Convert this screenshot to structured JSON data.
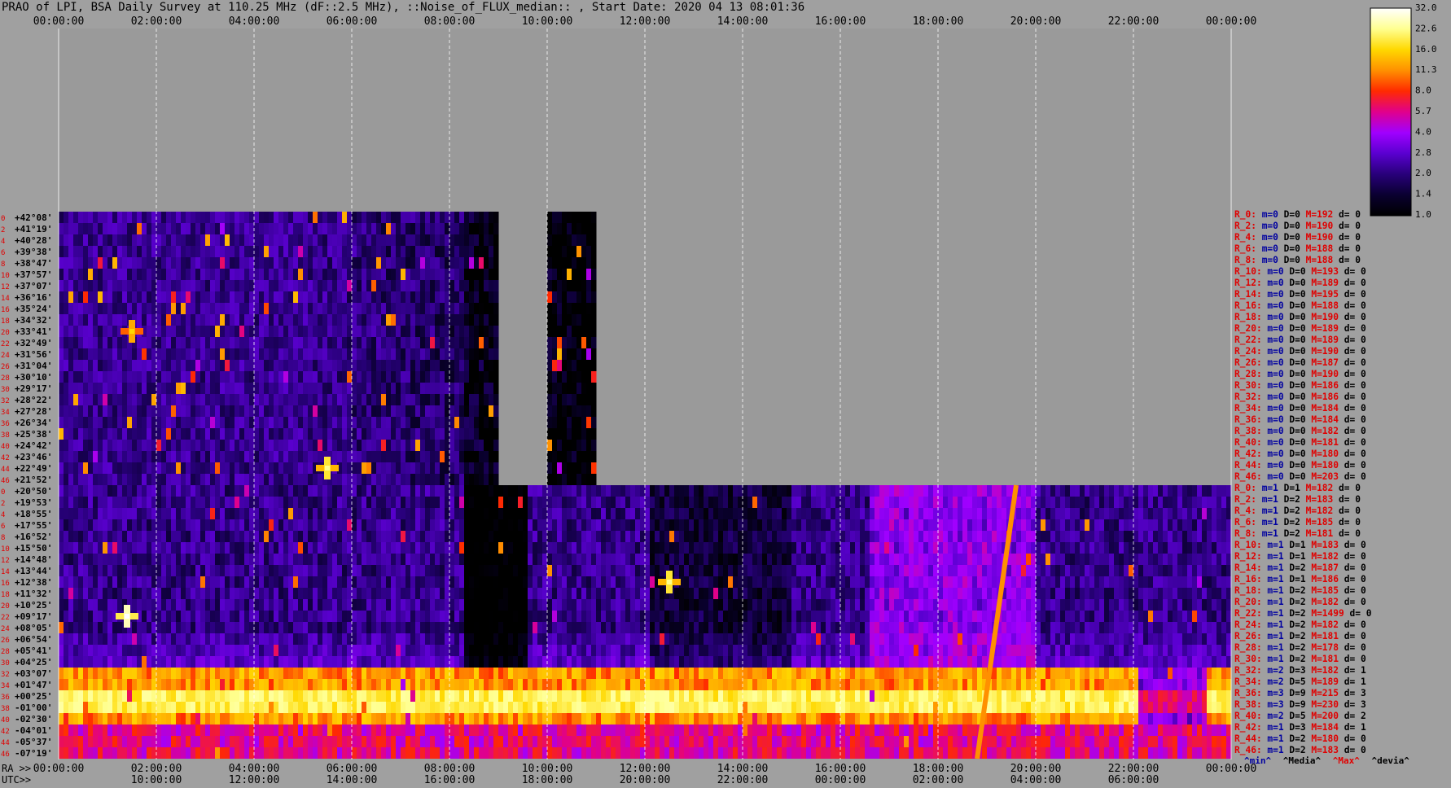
{
  "header": {
    "title": "PRAO of LPI, BSA Daily Survey at 110.25 MHz (dF::2.5 MHz), ::Noise_of_FLUX_median:: , Start Date: 2020 04 13 08:01:36"
  },
  "axes": {
    "ra_prefix": "RA >>",
    "utc_prefix": "UTC>>",
    "top_ticks": [
      "00:00:00",
      "02:00:00",
      "04:00:00",
      "06:00:00",
      "08:00:00",
      "10:00:00",
      "12:00:00",
      "14:00:00",
      "16:00:00",
      "18:00:00",
      "20:00:00",
      "22:00:00",
      "00:00:00"
    ],
    "ra_ticks": [
      "00:00:00",
      "02:00:00",
      "04:00:00",
      "06:00:00",
      "08:00:00",
      "10:00:00",
      "12:00:00",
      "14:00:00",
      "16:00:00",
      "18:00:00",
      "20:00:00",
      "22:00:00",
      "00:00:00"
    ],
    "utc_ticks": [
      "10:00:00",
      "12:00:00",
      "14:00:00",
      "16:00:00",
      "18:00:00",
      "20:00:00",
      "22:00:00",
      "00:00:00",
      "02:00:00",
      "04:00:00",
      "06:00:00"
    ]
  },
  "declinations": {
    "block1": [
      "+42°08'",
      "+41°19'",
      "+40°28'",
      "+39°38'",
      "+38°47'",
      "+37°57'",
      "+37°07'",
      "+36°16'",
      "+35°24'",
      "+34°32'",
      "+33°41'",
      "+32°49'",
      "+31°56'",
      "+31°04'",
      "+30°10'",
      "+29°17'",
      "+28°22'",
      "+27°28'",
      "+26°34'",
      "+25°38'",
      "+24°42'",
      "+23°46'",
      "+22°49'",
      "+21°52'"
    ],
    "block2": [
      "+20°50'",
      "+19°53'",
      "+18°55'",
      "+17°55'",
      "+16°52'",
      "+15°50'",
      "+14°48'",
      "+13°44'",
      "+12°38'",
      "+11°32'",
      "+10°25'",
      "+09°17'",
      "+08°05'",
      "+06°54'",
      "+05°41'",
      "+04°25'",
      "+03°07'",
      "+01°47'",
      "+00°25'",
      "-01°00'",
      "-02°30'",
      "-04°01'",
      "-05°37'",
      "-07°19'"
    ]
  },
  "row_indices": {
    "block1": [
      "0",
      "2",
      "4",
      "6",
      "8",
      "10",
      "12",
      "14",
      "16",
      "18",
      "20",
      "22",
      "24",
      "26",
      "28",
      "30",
      "32",
      "34",
      "36",
      "38",
      "40",
      "42",
      "44",
      "46"
    ],
    "block2": [
      "0",
      "2",
      "4",
      "6",
      "8",
      "10",
      "12",
      "14",
      "16",
      "18",
      "20",
      "22",
      "24",
      "26",
      "28",
      "30",
      "32",
      "34",
      "36",
      "38",
      "40",
      "42",
      "44",
      "46"
    ]
  },
  "colorbar": {
    "labels": [
      "32.0",
      "22.6",
      "16.0",
      "11.3",
      "8.0",
      "5.7",
      "4.0",
      "2.8",
      "2.0",
      "1.4",
      "1.0"
    ],
    "stops": [
      "#ffffff",
      "#ffff90",
      "#ffd800",
      "#ff9000",
      "#ff2a00",
      "#e0008c",
      "#a000ff",
      "#5a00d0",
      "#28007a",
      "#0a0030",
      "#000000"
    ]
  },
  "stats": {
    "rows": [
      {
        "r": "R_0:",
        "m": "m=0",
        "D": "D=0",
        "M": "M=192",
        "d": "d= 0"
      },
      {
        "r": "R_2:",
        "m": "m=0",
        "D": "D=0",
        "M": "M=190",
        "d": "d= 0"
      },
      {
        "r": "R_4:",
        "m": "m=0",
        "D": "D=0",
        "M": "M=190",
        "d": "d= 0"
      },
      {
        "r": "R_6:",
        "m": "m=0",
        "D": "D=0",
        "M": "M=188",
        "d": "d= 0"
      },
      {
        "r": "R_8:",
        "m": "m=0",
        "D": "D=0",
        "M": "M=188",
        "d": "d= 0"
      },
      {
        "r": "R_10:",
        "m": "m=0",
        "D": "D=0",
        "M": "M=193",
        "d": "d= 0"
      },
      {
        "r": "R_12:",
        "m": "m=0",
        "D": "D=0",
        "M": "M=189",
        "d": "d= 0"
      },
      {
        "r": "R_14:",
        "m": "m=0",
        "D": "D=0",
        "M": "M=195",
        "d": "d= 0"
      },
      {
        "r": "R_16:",
        "m": "m=0",
        "D": "D=0",
        "M": "M=188",
        "d": "d= 0"
      },
      {
        "r": "R_18:",
        "m": "m=0",
        "D": "D=0",
        "M": "M=190",
        "d": "d= 0"
      },
      {
        "r": "R_20:",
        "m": "m=0",
        "D": "D=0",
        "M": "M=189",
        "d": "d= 0"
      },
      {
        "r": "R_22:",
        "m": "m=0",
        "D": "D=0",
        "M": "M=189",
        "d": "d= 0"
      },
      {
        "r": "R_24:",
        "m": "m=0",
        "D": "D=0",
        "M": "M=190",
        "d": "d= 0"
      },
      {
        "r": "R_26:",
        "m": "m=0",
        "D": "D=0",
        "M": "M=187",
        "d": "d= 0"
      },
      {
        "r": "R_28:",
        "m": "m=0",
        "D": "D=0",
        "M": "M=190",
        "d": "d= 0"
      },
      {
        "r": "R_30:",
        "m": "m=0",
        "D": "D=0",
        "M": "M=186",
        "d": "d= 0"
      },
      {
        "r": "R_32:",
        "m": "m=0",
        "D": "D=0",
        "M": "M=186",
        "d": "d= 0"
      },
      {
        "r": "R_34:",
        "m": "m=0",
        "D": "D=0",
        "M": "M=184",
        "d": "d= 0"
      },
      {
        "r": "R_36:",
        "m": "m=0",
        "D": "D=0",
        "M": "M=184",
        "d": "d= 0"
      },
      {
        "r": "R_38:",
        "m": "m=0",
        "D": "D=0",
        "M": "M=182",
        "d": "d= 0"
      },
      {
        "r": "R_40:",
        "m": "m=0",
        "D": "D=0",
        "M": "M=181",
        "d": "d= 0"
      },
      {
        "r": "R_42:",
        "m": "m=0",
        "D": "D=0",
        "M": "M=180",
        "d": "d= 0"
      },
      {
        "r": "R_44:",
        "m": "m=0",
        "D": "D=0",
        "M": "M=180",
        "d": "d= 0"
      },
      {
        "r": "R_46:",
        "m": "m=0",
        "D": "D=0",
        "M": "M=203",
        "d": "d= 0"
      },
      {
        "r": "R_0:",
        "m": "m=1",
        "D": "D=1",
        "M": "M=182",
        "d": "d= 0"
      },
      {
        "r": "R_2:",
        "m": "m=1",
        "D": "D=2",
        "M": "M=183",
        "d": "d= 0"
      },
      {
        "r": "R_4:",
        "m": "m=1",
        "D": "D=2",
        "M": "M=182",
        "d": "d= 0"
      },
      {
        "r": "R_6:",
        "m": "m=1",
        "D": "D=2",
        "M": "M=185",
        "d": "d= 0"
      },
      {
        "r": "R_8:",
        "m": "m=1",
        "D": "D=2",
        "M": "M=181",
        "d": "d= 0"
      },
      {
        "r": "R_10:",
        "m": "m=1",
        "D": "D=1",
        "M": "M=183",
        "d": "d= 0"
      },
      {
        "r": "R_12:",
        "m": "m=1",
        "D": "D=1",
        "M": "M=182",
        "d": "d= 0"
      },
      {
        "r": "R_14:",
        "m": "m=1",
        "D": "D=2",
        "M": "M=187",
        "d": "d= 0"
      },
      {
        "r": "R_16:",
        "m": "m=1",
        "D": "D=1",
        "M": "M=186",
        "d": "d= 0"
      },
      {
        "r": "R_18:",
        "m": "m=1",
        "D": "D=2",
        "M": "M=185",
        "d": "d= 0"
      },
      {
        "r": "R_20:",
        "m": "m=1",
        "D": "D=2",
        "M": "M=182",
        "d": "d= 0"
      },
      {
        "r": "R_22:",
        "m": "m=1",
        "D": "D=2",
        "M": "M=1499",
        "d": "d= 0"
      },
      {
        "r": "R_24:",
        "m": "m=1",
        "D": "D=2",
        "M": "M=182",
        "d": "d= 0"
      },
      {
        "r": "R_26:",
        "m": "m=1",
        "D": "D=2",
        "M": "M=181",
        "d": "d= 0"
      },
      {
        "r": "R_28:",
        "m": "m=1",
        "D": "D=2",
        "M": "M=178",
        "d": "d= 0"
      },
      {
        "r": "R_30:",
        "m": "m=1",
        "D": "D=2",
        "M": "M=181",
        "d": "d= 0"
      },
      {
        "r": "R_32:",
        "m": "m=2",
        "D": "D=3",
        "M": "M=182",
        "d": "d= 1"
      },
      {
        "r": "R_34:",
        "m": "m=2",
        "D": "D=5",
        "M": "M=189",
        "d": "d= 1"
      },
      {
        "r": "R_36:",
        "m": "m=3",
        "D": "D=9",
        "M": "M=215",
        "d": "d= 3"
      },
      {
        "r": "R_38:",
        "m": "m=3",
        "D": "D=9",
        "M": "M=230",
        "d": "d= 3"
      },
      {
        "r": "R_40:",
        "m": "m=2",
        "D": "D=5",
        "M": "M=200",
        "d": "d= 2"
      },
      {
        "r": "R_42:",
        "m": "m=1",
        "D": "D=3",
        "M": "M=184",
        "d": "d= 1"
      },
      {
        "r": "R_44:",
        "m": "m=1",
        "D": "D=2",
        "M": "M=180",
        "d": "d= 0"
      },
      {
        "r": "R_46:",
        "m": "m=1",
        "D": "D=2",
        "M": "M=183",
        "d": "d= 0"
      }
    ],
    "footer": {
      "min": "^min^",
      "media": "^Media^",
      "max": "^Max^",
      "devia": "^devia^"
    }
  },
  "chart_data": {
    "type": "heatmap",
    "title": "PRAO of LPI, BSA Daily Survey at 110.25 MHz (dF::2.5 MHz), ::Noise_of_FLUX_median:: , Start Date: 2020 04 13 08:01:36",
    "x_axis_top": "RA 00:00:00 to 00:00:00 (24 h)",
    "x_axis_bottom": "UTC 10:00:00 ...",
    "xlim_hours": [
      0,
      24
    ],
    "color_scale": "log",
    "color_range": [
      1.0,
      32.0
    ],
    "grid": true,
    "blocks": [
      {
        "name": "block1",
        "dec_range": [
          "+42°08'",
          "+21°52'"
        ],
        "rows": 24,
        "data_ra_hours": [
          [
            0,
            9.0
          ],
          [
            10.0,
            11.0
          ]
        ]
      },
      {
        "name": "block2",
        "dec_range": [
          "+20°50'",
          "-07°19'"
        ],
        "rows": 24,
        "data_ra_hours": [
          [
            0,
            24.0
          ]
        ]
      }
    ],
    "features": [
      {
        "label": "galactic plane band",
        "block": "block2",
        "dec_range": [
          "+01°47'",
          "-02°30'"
        ],
        "level_approx": 16.0
      },
      {
        "label": "bright source",
        "block": "block2",
        "ra_hour": 1.4,
        "dec": "+09°17'",
        "level_approx": 32.0
      },
      {
        "label": "bright source",
        "block": "block2",
        "ra_hour": 12.5,
        "dec": "+12°38'",
        "level_approx": 22.6
      },
      {
        "label": "bright source",
        "block": "block1",
        "ra_hour": 5.5,
        "dec": "+22°49'",
        "level_approx": 22.6
      },
      {
        "label": "bright source",
        "block": "block1",
        "ra_hour": 1.5,
        "dec": "+33°41'",
        "level_approx": 16.0
      },
      {
        "label": "drifting interference track",
        "block": "block2",
        "ra_hour_range": [
          18.8,
          19.6
        ],
        "level_approx": 11.3
      }
    ]
  }
}
